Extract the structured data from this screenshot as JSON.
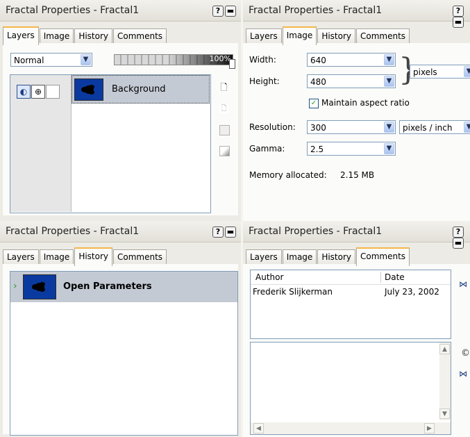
{
  "panels": {
    "layers": {
      "title": "Fractal Properties - Fractal1",
      "help_label": "?",
      "tabs": [
        "Layers",
        "Image",
        "History",
        "Comments"
      ],
      "blend_mode": "Normal",
      "opacity": "100%",
      "opacity_fraction": 1.0,
      "layer_name": "Background"
    },
    "image": {
      "title": "Fractal Properties - Fractal1",
      "help_label": "?",
      "tabs": [
        "Layers",
        "Image",
        "History",
        "Comments"
      ],
      "width_label": "Width:",
      "width_value": "640",
      "height_label": "Height:",
      "height_value": "480",
      "size_unit": "pixels",
      "maintain_label": "Maintain aspect ratio",
      "maintain_checked": true,
      "resolution_label": "Resolution:",
      "resolution_value": "300",
      "resolution_unit": "pixels / inch",
      "gamma_label": "Gamma:",
      "gamma_value": "2.5",
      "memory_label": "Memory allocated:",
      "memory_value": "2.15 MB"
    },
    "history": {
      "title": "Fractal Properties - Fractal1",
      "help_label": "?",
      "tabs": [
        "Layers",
        "Image",
        "History",
        "Comments"
      ],
      "item_label": "Open Parameters"
    },
    "comments": {
      "title": "Fractal Properties - Fractal1",
      "help_label": "?",
      "tabs": [
        "Layers",
        "Image",
        "History",
        "Comments"
      ],
      "col_author": "Author",
      "col_date": "Date",
      "rows": [
        {
          "author": "Frederik Slijkerman",
          "date": "July 23, 2002"
        }
      ]
    }
  },
  "colors": {
    "tab_accent": "#f7b64a",
    "selection": "#c4cad4",
    "thumb_bg": "#0a3aa0"
  },
  "icons": [
    "help-icon",
    "minimize-icon",
    "dropdown-arrow-icon",
    "visibility-icon",
    "zoom-icon",
    "lock-icon",
    "new-layer-icon",
    "delete-layer-icon",
    "layer-props-icon",
    "mask-icon",
    "history-step-icon",
    "navigate-icon",
    "copyright-icon"
  ]
}
